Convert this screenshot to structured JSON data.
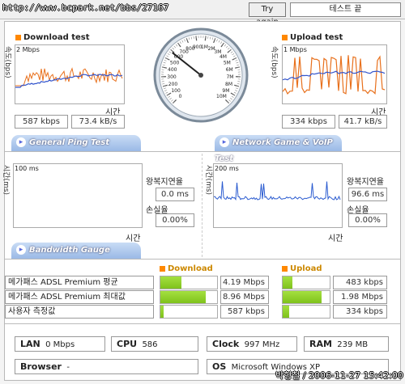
{
  "header": {
    "url": "http://www.bcpark.net/bbs/27167",
    "try_again": "Try again",
    "status": "테스트 끝"
  },
  "download": {
    "title": "Download test",
    "ylabel": "속도(bps)",
    "scale": "2 Mbps",
    "xlabel": "시간",
    "kbps": "587 kbps",
    "kBs": "73.4 kB/s",
    "color": "#e8701c"
  },
  "upload": {
    "title": "Upload test",
    "ylabel": "속도(bps)",
    "scale": "1 Mbps",
    "xlabel": "시간",
    "kbps": "334 kbps",
    "kBs": "41.7 kB/s"
  },
  "gauge": {
    "ticks": [
      "0",
      "100",
      "200",
      "300",
      "400",
      "500",
      "600",
      "700",
      "800",
      "900",
      "1M",
      "2M",
      "3M",
      "4M",
      "5M",
      "6M",
      "7M",
      "8M",
      "9M",
      "10M"
    ],
    "needle_value": "587 kbps"
  },
  "ping": {
    "tab": "General Ping Test",
    "ylabel": "시간(ms)",
    "scale": "100 ms",
    "xlabel": "시간",
    "rtt_label": "왕복지연율",
    "rtt_value": "0.0 ms",
    "loss_label": "손실율",
    "loss_value": "0.00%"
  },
  "game": {
    "tab": "Network Game & VoIP Test",
    "ylabel": "시간(ms)",
    "scale": "200 ms",
    "xlabel": "시간",
    "rtt_label": "왕복지연율",
    "rtt_value": "96.6 ms",
    "loss_label": "손실율",
    "loss_value": "0.00%",
    "color": "#2a5bd0"
  },
  "bandwidth": {
    "tab": "Bandwidth Gauge",
    "download_header": "Download",
    "upload_header": "Upload",
    "rows": [
      {
        "label": "메가패스 ADSL Premium 평균",
        "down": "4.19 Mbps",
        "down_level": 0.37,
        "up": "483 kbps",
        "up_level": 0.2
      },
      {
        "label": "메가패스 ADSL Premium 최대값",
        "down": "8.96 Mbps",
        "down_level": 0.8,
        "up": "1.98 Mbps",
        "up_level": 0.82
      },
      {
        "label": "사용자 측정값",
        "down": "587 kbps",
        "down_level": 0.06,
        "up": "334 kbps",
        "up_level": 0.14
      }
    ]
  },
  "system": {
    "lan_label": "LAN",
    "lan_value": "0 Mbps",
    "cpu_label": "CPU",
    "cpu_value": "586",
    "clock_label": "Clock",
    "clock_value": "997 MHz",
    "ram_label": "RAM",
    "ram_value": "239 MB",
    "browser_label": "Browser",
    "browser_value": "-",
    "os_label": "OS",
    "os_value": "Microsoft Windows XP",
    "watermark": "박형철 / 2006-11-27 15:42:00"
  }
}
